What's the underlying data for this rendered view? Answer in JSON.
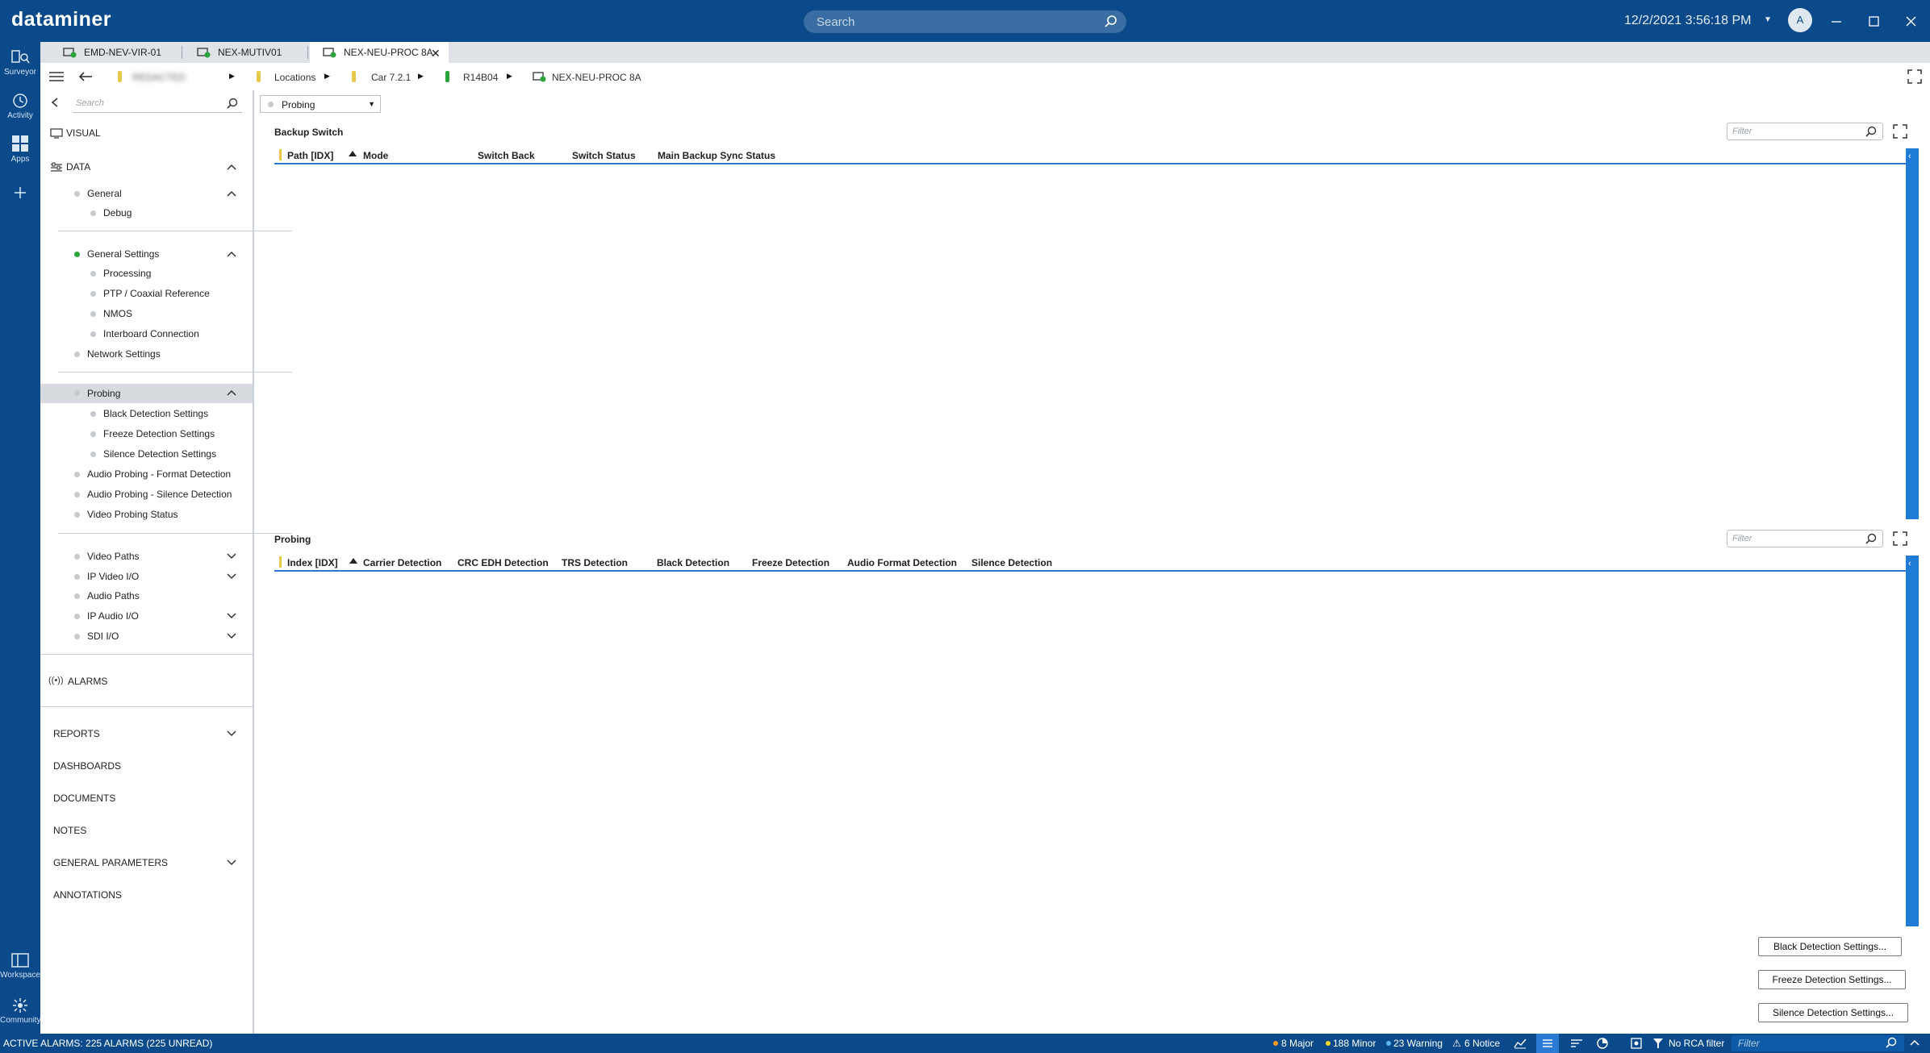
{
  "app": {
    "brand": "dataminer",
    "search_placeholder": "Search",
    "datetime": "12/2/2021 3:56:18 PM",
    "avatar_initial": "A"
  },
  "rail": {
    "surveyor": "Surveyor",
    "activity": "Activity",
    "apps": "Apps",
    "workspace": "Workspace",
    "community": "Community"
  },
  "tabs": [
    {
      "label": "EMD-NEV-VIR-01",
      "active": false
    },
    {
      "label": "NEX-MUTIV01",
      "active": false
    },
    {
      "label": "NEX-NEU-PROC 8A",
      "active": true
    }
  ],
  "breadcrumb": {
    "hidden_item": "REDACTED",
    "locations": "Locations",
    "car": "Car 7.2.1",
    "rack": "R14B04",
    "element": "NEX-NEU-PROC 8A"
  },
  "sidebar": {
    "search_placeholder": "Search",
    "visual": "VISUAL",
    "data": "DATA",
    "general": "General",
    "debug": "Debug",
    "general_settings": "General Settings",
    "processing": "Processing",
    "ptp": "PTP / Coaxial Reference",
    "nmos": "NMOS",
    "interboard": "Interboard Connection",
    "network_settings": "Network Settings",
    "probing": "Probing",
    "black_detection": "Black Detection Settings",
    "freeze_detection": "Freeze Detection Settings",
    "silence_detection": "Silence Detection Settings",
    "audio_format": "Audio Probing - Format Detection",
    "audio_silence": "Audio Probing - Silence Detection",
    "video_status": "Video Probing Status",
    "video_paths": "Video Paths",
    "ip_video": "IP Video I/O",
    "audio_paths": "Audio Paths",
    "ip_audio": "IP Audio I/O",
    "sdi": "SDI I/O",
    "alarms": "ALARMS",
    "reports": "REPORTS",
    "dashboards": "DASHBOARDS",
    "documents": "DOCUMENTS",
    "notes": "NOTES",
    "general_parameters": "GENERAL PARAMETERS",
    "annotations": "ANNOTATIONS"
  },
  "main": {
    "page_select": "Probing",
    "filter_placeholder": "Filter",
    "backup": {
      "title": "Backup Switch",
      "columns": [
        "Path [IDX]",
        "Mode",
        "Switch Back",
        "Switch Status",
        "Main Backup Sync Status"
      ]
    },
    "probing": {
      "title": "Probing",
      "columns": [
        "Index [IDX]",
        "Carrier Detection",
        "CRC EDH Detection",
        "TRS Detection",
        "Black Detection",
        "Freeze Detection",
        "Audio Format Detection",
        "Silence Detection"
      ]
    },
    "buttons": {
      "black": "Black Detection Settings...",
      "freeze": "Freeze Detection Settings...",
      "silence": "Silence Detection Settings..."
    }
  },
  "statusbar": {
    "active_alarms": "ACTIVE ALARMS: 225 ALARMS (225 UNREAD)",
    "major": "8 Major",
    "minor": "188 Minor",
    "warning": "23 Warning",
    "notice": "6 Notice",
    "rca": "No RCA filter",
    "filter_placeholder": "Filter",
    "colors": {
      "major": "#f59a23",
      "minor": "#f5d623",
      "warning": "#5fb7f0",
      "notice": "#f5d623"
    }
  }
}
